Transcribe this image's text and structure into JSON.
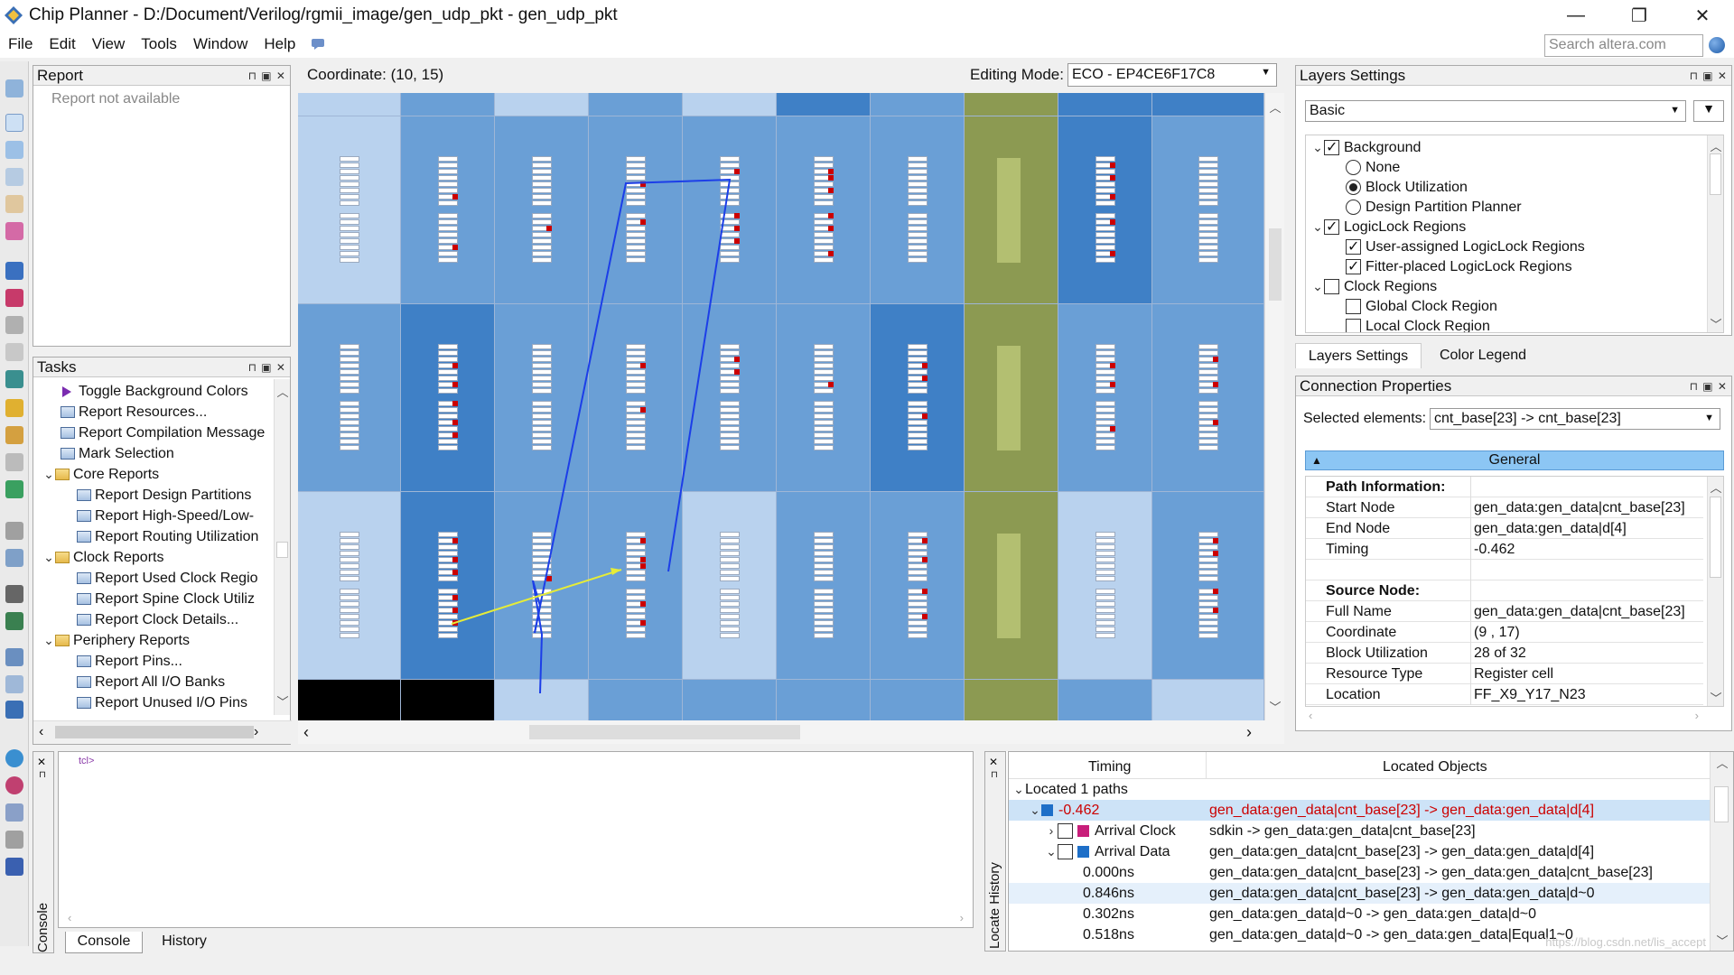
{
  "window": {
    "title": "Chip Planner - D:/Document/Verilog/rgmii_image/gen_udp_pkt - gen_udp_pkt",
    "minimize": "—",
    "restore": "❐",
    "close": "✕"
  },
  "menu": [
    "File",
    "Edit",
    "View",
    "Tools",
    "Window",
    "Help"
  ],
  "search": {
    "placeholder": "Search altera.com"
  },
  "report_panel": {
    "title": "Report",
    "empty_text": "Report not available"
  },
  "tasks_panel": {
    "title": "Tasks",
    "items": [
      {
        "label": "Toggle Background Colors",
        "icon": "triangle-icon",
        "indent": 1
      },
      {
        "label": "Report Resources...",
        "icon": "report-icon",
        "indent": 1
      },
      {
        "label": "Report Compilation Message",
        "icon": "report-icon",
        "indent": 1
      },
      {
        "label": "Mark Selection",
        "icon": "table-icon",
        "indent": 1
      },
      {
        "label": "Core Reports",
        "icon": "folder-icon",
        "indent": 0,
        "expanded": true
      },
      {
        "label": "Report Design Partitions",
        "icon": "report-icon",
        "indent": 2
      },
      {
        "label": "Report High-Speed/Low-",
        "icon": "report-icon",
        "indent": 2
      },
      {
        "label": "Report Routing Utilization",
        "icon": "report-icon",
        "indent": 2
      },
      {
        "label": "Clock Reports",
        "icon": "folder-icon",
        "indent": 0,
        "expanded": true
      },
      {
        "label": "Report Used Clock Regio",
        "icon": "report-icon",
        "indent": 2
      },
      {
        "label": "Report Spine Clock Utiliz",
        "icon": "report-icon",
        "indent": 2
      },
      {
        "label": "Report Clock Details...",
        "icon": "report-icon",
        "indent": 2
      },
      {
        "label": "Periphery Reports",
        "icon": "folder-icon",
        "indent": 0,
        "expanded": true
      },
      {
        "label": "Report Pins...",
        "icon": "report-icon",
        "indent": 2
      },
      {
        "label": "Report All I/O Banks",
        "icon": "report-icon",
        "indent": 2
      },
      {
        "label": "Report Unused I/O Pins",
        "icon": "report-icon",
        "indent": 2
      }
    ]
  },
  "canvas": {
    "coordinate_label": "Coordinate: (10, 15)",
    "editing_mode_label": "Editing Mode:",
    "editing_mode_value": "ECO - EP4CE6F17C8"
  },
  "layers_panel": {
    "title": "Layers Settings",
    "preset": "Basic",
    "items": [
      {
        "label": "Background",
        "control": "check",
        "on": true,
        "indent": 0,
        "expanded": true
      },
      {
        "label": "None",
        "control": "radio",
        "on": false,
        "indent": 1
      },
      {
        "label": "Block Utilization",
        "control": "radio",
        "on": true,
        "indent": 1
      },
      {
        "label": "Design Partition Planner",
        "control": "radio",
        "on": false,
        "indent": 1
      },
      {
        "label": "LogicLock Regions",
        "control": "check",
        "on": true,
        "indent": 0,
        "expanded": true
      },
      {
        "label": "User-assigned LogicLock Regions",
        "control": "check",
        "on": true,
        "indent": 1
      },
      {
        "label": "Fitter-placed LogicLock Regions",
        "control": "check",
        "on": true,
        "indent": 1
      },
      {
        "label": "Clock Regions",
        "control": "check",
        "on": false,
        "indent": 0,
        "expanded": true
      },
      {
        "label": "Global Clock Region",
        "control": "check",
        "on": false,
        "indent": 1
      },
      {
        "label": "Local Clock Region",
        "control": "check",
        "on": false,
        "indent": 1
      }
    ],
    "tabs": [
      "Layers Settings",
      "Color Legend"
    ]
  },
  "connection_panel": {
    "title": "Connection Properties",
    "selected_label": "Selected elements:",
    "selected_value": "cnt_base[23] -> cnt_base[23]",
    "section": "General",
    "rows": [
      {
        "k": "Path Information:",
        "v": "",
        "bold": true
      },
      {
        "k": "Start Node",
        "v": "gen_data:gen_data|cnt_base[23]"
      },
      {
        "k": "End Node",
        "v": "gen_data:gen_data|d[4]"
      },
      {
        "k": "Timing",
        "v": "-0.462"
      },
      {
        "k": "",
        "v": ""
      },
      {
        "k": "Source Node:",
        "v": "",
        "bold": true
      },
      {
        "k": "Full Name",
        "v": "gen_data:gen_data|cnt_base[23]"
      },
      {
        "k": "Coordinate",
        "v": "(9 , 17)"
      },
      {
        "k": "Block Utilization",
        "v": "28 of 32"
      },
      {
        "k": "Resource Type",
        "v": "Register cell"
      },
      {
        "k": "Location",
        "v": "FF_X9_Y17_N23"
      }
    ]
  },
  "console": {
    "prompt": "tcl>",
    "side_label": "Console",
    "tabs": [
      "Console",
      "History"
    ]
  },
  "locate_history": {
    "side_label": "Locate History",
    "col_timing": "Timing",
    "col_objects": "Located Objects",
    "summary": "Located 1 paths",
    "rows": [
      {
        "timing": "-0.462",
        "object": "gen_data:gen_data|cnt_base[23] -> gen_data:gen_data|d[4]",
        "kind": "path"
      },
      {
        "timing": "Arrival Clock",
        "object": "sdkin -> gen_data:gen_data|cnt_base[23]",
        "kind": "clock"
      },
      {
        "timing": "Arrival Data",
        "object": "gen_data:gen_data|cnt_base[23] -> gen_data:gen_data|d[4]",
        "kind": "data"
      },
      {
        "timing": "0.000ns",
        "object": "gen_data:gen_data|cnt_base[23] -> gen_data:gen_data|cnt_base[23]",
        "kind": "step"
      },
      {
        "timing": "0.846ns",
        "object": "gen_data:gen_data|cnt_base[23] -> gen_data:gen_data|d~0",
        "kind": "step"
      },
      {
        "timing": "0.302ns",
        "object": "gen_data:gen_data|d~0 -> gen_data:gen_data|d~0",
        "kind": "step"
      },
      {
        "timing": "0.518ns",
        "object": "gen_data:gen_data|d~0 -> gen_data:gen_data|Equal1~0",
        "kind": "step"
      }
    ],
    "watermark": "https://blog.csdn.net/lis_accept"
  },
  "colors": {
    "accent": "#3399ff",
    "path_red": "#cc0000",
    "selected_row": "#cde3f7",
    "lab_dark": "#3f80c6",
    "lab_mid": "#6a9fd6",
    "lab_light": "#b9d2ee",
    "ram_column": "#8c9a52"
  }
}
